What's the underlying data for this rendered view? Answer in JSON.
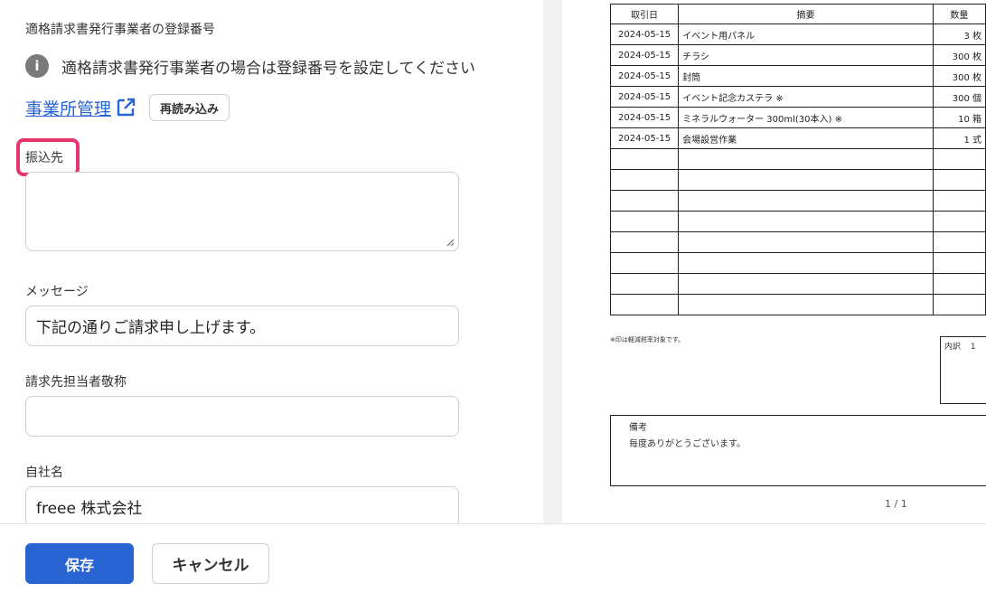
{
  "form": {
    "registration_label": "適格請求書発行事業者の登録番号",
    "registration_info": "適格請求書発行事業者の場合は登録番号を設定してください",
    "info_icon": "info-icon",
    "office_link": "事業所管理",
    "external_icon": "external-link-icon",
    "reload_button": "再読み込み",
    "bank_label": "振込先",
    "bank_value": "",
    "message_label": "メッセージ",
    "message_value": "下記の通りご請求申し上げます。",
    "honorific_label": "請求先担当者敬称",
    "honorific_value": "",
    "company_label": "自社名",
    "company_value": "freee 株式会社"
  },
  "preview": {
    "headers": {
      "date": "取引日",
      "desc": "摘要",
      "qty": "数量"
    },
    "rows": [
      {
        "date": "2024-05-15",
        "desc": "イベント用パネル",
        "qty": "3 枚"
      },
      {
        "date": "2024-05-15",
        "desc": "チラシ",
        "qty": "300 枚"
      },
      {
        "date": "2024-05-15",
        "desc": "封筒",
        "qty": "300 枚"
      },
      {
        "date": "2024-05-15",
        "desc": "イベント記念カステラ ※",
        "qty": "300 個"
      },
      {
        "date": "2024-05-15",
        "desc": "ミネラルウォーター 300ml(30本入) ※",
        "qty": "10 箱"
      },
      {
        "date": "2024-05-15",
        "desc": "会場設営作業",
        "qty": "1 式"
      }
    ],
    "reduced_tax_note": "※印は軽減税率対象です。",
    "breakdown_label": "内訳",
    "breakdown_first": "1",
    "remarks_label": "備考",
    "remarks_text": "毎度ありがとうございます。",
    "page_indicator": "1 / 1"
  },
  "footer": {
    "save": "保存",
    "cancel": "キャンセル"
  },
  "colors": {
    "primary": "#2864d2",
    "highlight": "#e8336b"
  }
}
